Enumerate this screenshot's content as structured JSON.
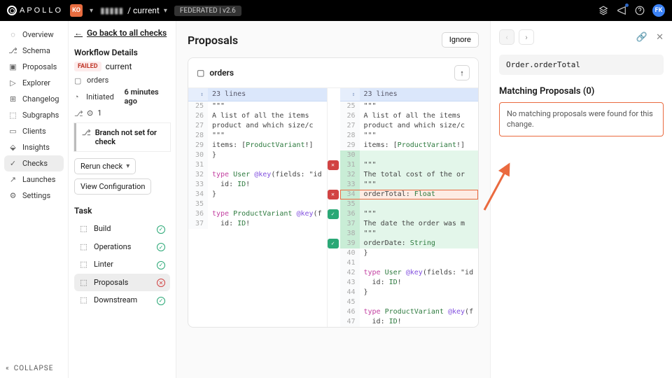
{
  "topbar": {
    "logo": "APOLLO",
    "org_badge": "KO",
    "org_name_masked": "▮▮▮▮▮",
    "graph_crumb": "/ current",
    "variant_pill": "FEDERATED | v2.6",
    "avatar": "FK"
  },
  "sidenav": {
    "items": [
      {
        "label": "Overview",
        "icon": "gauge"
      },
      {
        "label": "Schema",
        "icon": "branches"
      },
      {
        "label": "Proposals",
        "icon": "proposals"
      },
      {
        "label": "Explorer",
        "icon": "play-box"
      },
      {
        "label": "Changelog",
        "icon": "plus-box"
      },
      {
        "label": "Subgraphs",
        "icon": "subgraphs"
      },
      {
        "label": "Clients",
        "icon": "clients"
      },
      {
        "label": "Insights",
        "icon": "insights"
      },
      {
        "label": "Checks",
        "icon": "check",
        "active": true
      },
      {
        "label": "Launches",
        "icon": "rocket"
      },
      {
        "label": "Settings",
        "icon": "gear"
      }
    ],
    "collapse": "COLLAPSE"
  },
  "workflow": {
    "back": "Go back to all checks",
    "heading": "Workflow Details",
    "status": "FAILED",
    "variant": "current",
    "subgraph": "orders",
    "initiated_label": "Initiated",
    "initiated_ago": "6 minutes ago",
    "pr_count": "1",
    "branch_note": "Branch not set for check",
    "rerun": "Rerun check",
    "view_config": "View Configuration",
    "task_heading": "Task",
    "tasks": [
      {
        "label": "Build",
        "status": "ok"
      },
      {
        "label": "Operations",
        "status": "ok"
      },
      {
        "label": "Linter",
        "status": "ok"
      },
      {
        "label": "Proposals",
        "status": "fail",
        "active": true
      },
      {
        "label": "Downstream",
        "status": "ok"
      }
    ]
  },
  "main": {
    "title": "Proposals",
    "ignore": "Ignore",
    "file": "orders",
    "hunk": "23 lines",
    "left": [
      {
        "n": "25",
        "t": "\"\"\""
      },
      {
        "n": "26",
        "t": "A list of all the items"
      },
      {
        "n": "27",
        "t": "product and which size/c"
      },
      {
        "n": "28",
        "t": "\"\"\""
      },
      {
        "n": "29",
        "t": "items: [ProductVariant!]"
      },
      {
        "n": "",
        "t": ""
      },
      {
        "n": "",
        "t": ""
      },
      {
        "n": "",
        "t": ""
      },
      {
        "n": "",
        "t": ""
      },
      {
        "n": "",
        "t": ""
      },
      {
        "n": "",
        "t": ""
      },
      {
        "n": "",
        "t": ""
      },
      {
        "n": "",
        "t": ""
      },
      {
        "n": "",
        "t": ""
      },
      {
        "n": "",
        "t": ""
      },
      {
        "n": "30",
        "t": "}"
      },
      {
        "n": "31",
        "t": ""
      },
      {
        "n": "32",
        "t": "type User @key(fields: \"id"
      },
      {
        "n": "33",
        "t": "  id: ID!"
      },
      {
        "n": "34",
        "t": "}"
      },
      {
        "n": "35",
        "t": ""
      },
      {
        "n": "36",
        "t": "type ProductVariant @key(f"
      },
      {
        "n": "37",
        "t": "  id: ID!"
      }
    ],
    "right": [
      {
        "n": "25",
        "t": "\"\"\""
      },
      {
        "n": "26",
        "t": "A list of all the items"
      },
      {
        "n": "27",
        "t": "product and which size/c"
      },
      {
        "n": "28",
        "t": "\"\"\""
      },
      {
        "n": "29",
        "t": "items: [ProductVariant!]"
      },
      {
        "n": "30",
        "t": "",
        "add": true
      },
      {
        "n": "31",
        "t": "\"\"\"",
        "add": true,
        "marker": "del"
      },
      {
        "n": "32",
        "t": "The total cost of the or",
        "add": true
      },
      {
        "n": "33",
        "t": "\"\"\"",
        "add": true
      },
      {
        "n": "34",
        "t": "orderTotal: Float",
        "add": true,
        "hl": true,
        "marker": "del"
      },
      {
        "n": "35",
        "t": "",
        "add": true
      },
      {
        "n": "36",
        "t": "\"\"\"",
        "add": true,
        "marker": "addm"
      },
      {
        "n": "37",
        "t": "The date the order was m",
        "add": true
      },
      {
        "n": "38",
        "t": "\"\"\"",
        "add": true
      },
      {
        "n": "39",
        "t": "orderDate: String",
        "add": true,
        "marker": "addm"
      },
      {
        "n": "40",
        "t": "}"
      },
      {
        "n": "41",
        "t": ""
      },
      {
        "n": "42",
        "t": "type User @key(fields: \"id"
      },
      {
        "n": "43",
        "t": "  id: ID!"
      },
      {
        "n": "44",
        "t": "}"
      },
      {
        "n": "45",
        "t": ""
      },
      {
        "n": "46",
        "t": "type ProductVariant @key(f"
      },
      {
        "n": "47",
        "t": "  id: ID!"
      }
    ]
  },
  "rpanel": {
    "field": "Order.orderTotal",
    "heading": "Matching Proposals (0)",
    "empty": "No matching proposals were found for this change."
  }
}
